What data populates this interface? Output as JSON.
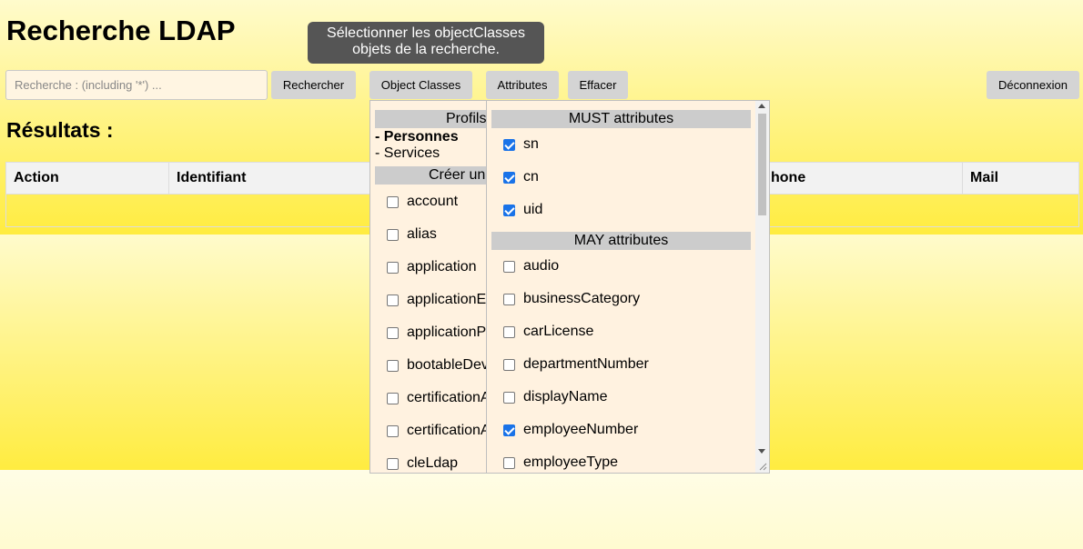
{
  "page": {
    "title": "Recherche LDAP"
  },
  "tooltip": {
    "text_line1": "Sélectionner les objectClasses",
    "text_line2": "objets de la recherche."
  },
  "search": {
    "placeholder": "Recherche : (including '*') ...",
    "value": ""
  },
  "toolbar": {
    "search_label": "Rechercher",
    "object_classes_label": "Object Classes",
    "attributes_label": "Attributes",
    "clear_label": "Effacer",
    "logout_label": "Déconnexion"
  },
  "results": {
    "heading": "Résultats :",
    "columns": [
      "Action",
      "Identifiant",
      "hone",
      "Mail"
    ]
  },
  "object_classes_panel": {
    "profiles_header": "Profils",
    "profiles": [
      "- Personnes",
      "- Services"
    ],
    "create_header": "Créer un",
    "classes": [
      {
        "label": "account",
        "checked": false
      },
      {
        "label": "alias",
        "checked": false
      },
      {
        "label": "application",
        "checked": false
      },
      {
        "label": "applicationEr",
        "checked": false
      },
      {
        "label": "applicationPr",
        "checked": false
      },
      {
        "label": "bootableDev",
        "checked": false
      },
      {
        "label": "certificationA",
        "checked": false
      },
      {
        "label": "certificationA",
        "checked": false
      },
      {
        "label": "cleLdap",
        "checked": false
      }
    ]
  },
  "attributes_panel": {
    "must_header": "MUST attributes",
    "must": [
      {
        "label": "sn",
        "checked": true
      },
      {
        "label": "cn",
        "checked": true
      },
      {
        "label": "uid",
        "checked": true
      }
    ],
    "may_header": "MAY attributes",
    "may": [
      {
        "label": "audio",
        "checked": false
      },
      {
        "label": "businessCategory",
        "checked": false
      },
      {
        "label": "carLicense",
        "checked": false
      },
      {
        "label": "departmentNumber",
        "checked": false
      },
      {
        "label": "displayName",
        "checked": false
      },
      {
        "label": "employeeNumber",
        "checked": true
      },
      {
        "label": "employeeType",
        "checked": false
      }
    ]
  },
  "colors": {
    "accent": "#1a73e8",
    "band_top": "#fffbcc",
    "band_bottom": "#ffec40"
  }
}
